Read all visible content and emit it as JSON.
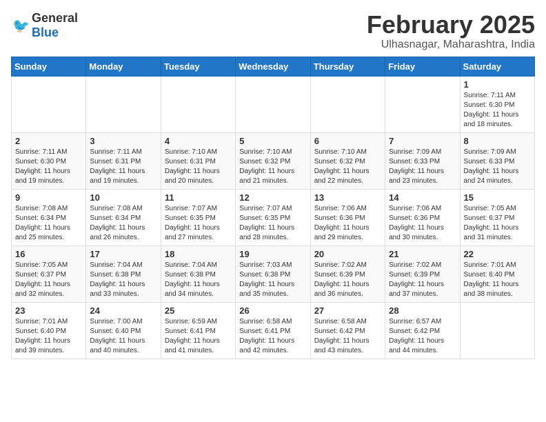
{
  "logo": {
    "general": "General",
    "blue": "Blue"
  },
  "title": "February 2025",
  "location": "Ulhasnagar, Maharashtra, India",
  "weekdays": [
    "Sunday",
    "Monday",
    "Tuesday",
    "Wednesday",
    "Thursday",
    "Friday",
    "Saturday"
  ],
  "weeks": [
    [
      {
        "day": "",
        "info": ""
      },
      {
        "day": "",
        "info": ""
      },
      {
        "day": "",
        "info": ""
      },
      {
        "day": "",
        "info": ""
      },
      {
        "day": "",
        "info": ""
      },
      {
        "day": "",
        "info": ""
      },
      {
        "day": "1",
        "info": "Sunrise: 7:11 AM\nSunset: 6:30 PM\nDaylight: 11 hours and 18 minutes."
      }
    ],
    [
      {
        "day": "2",
        "info": "Sunrise: 7:11 AM\nSunset: 6:30 PM\nDaylight: 11 hours and 19 minutes."
      },
      {
        "day": "3",
        "info": "Sunrise: 7:11 AM\nSunset: 6:31 PM\nDaylight: 11 hours and 19 minutes."
      },
      {
        "day": "4",
        "info": "Sunrise: 7:10 AM\nSunset: 6:31 PM\nDaylight: 11 hours and 20 minutes."
      },
      {
        "day": "5",
        "info": "Sunrise: 7:10 AM\nSunset: 6:32 PM\nDaylight: 11 hours and 21 minutes."
      },
      {
        "day": "6",
        "info": "Sunrise: 7:10 AM\nSunset: 6:32 PM\nDaylight: 11 hours and 22 minutes."
      },
      {
        "day": "7",
        "info": "Sunrise: 7:09 AM\nSunset: 6:33 PM\nDaylight: 11 hours and 23 minutes."
      },
      {
        "day": "8",
        "info": "Sunrise: 7:09 AM\nSunset: 6:33 PM\nDaylight: 11 hours and 24 minutes."
      }
    ],
    [
      {
        "day": "9",
        "info": "Sunrise: 7:08 AM\nSunset: 6:34 PM\nDaylight: 11 hours and 25 minutes."
      },
      {
        "day": "10",
        "info": "Sunrise: 7:08 AM\nSunset: 6:34 PM\nDaylight: 11 hours and 26 minutes."
      },
      {
        "day": "11",
        "info": "Sunrise: 7:07 AM\nSunset: 6:35 PM\nDaylight: 11 hours and 27 minutes."
      },
      {
        "day": "12",
        "info": "Sunrise: 7:07 AM\nSunset: 6:35 PM\nDaylight: 11 hours and 28 minutes."
      },
      {
        "day": "13",
        "info": "Sunrise: 7:06 AM\nSunset: 6:36 PM\nDaylight: 11 hours and 29 minutes."
      },
      {
        "day": "14",
        "info": "Sunrise: 7:06 AM\nSunset: 6:36 PM\nDaylight: 11 hours and 30 minutes."
      },
      {
        "day": "15",
        "info": "Sunrise: 7:05 AM\nSunset: 6:37 PM\nDaylight: 11 hours and 31 minutes."
      }
    ],
    [
      {
        "day": "16",
        "info": "Sunrise: 7:05 AM\nSunset: 6:37 PM\nDaylight: 11 hours and 32 minutes."
      },
      {
        "day": "17",
        "info": "Sunrise: 7:04 AM\nSunset: 6:38 PM\nDaylight: 11 hours and 33 minutes."
      },
      {
        "day": "18",
        "info": "Sunrise: 7:04 AM\nSunset: 6:38 PM\nDaylight: 11 hours and 34 minutes."
      },
      {
        "day": "19",
        "info": "Sunrise: 7:03 AM\nSunset: 6:38 PM\nDaylight: 11 hours and 35 minutes."
      },
      {
        "day": "20",
        "info": "Sunrise: 7:02 AM\nSunset: 6:39 PM\nDaylight: 11 hours and 36 minutes."
      },
      {
        "day": "21",
        "info": "Sunrise: 7:02 AM\nSunset: 6:39 PM\nDaylight: 11 hours and 37 minutes."
      },
      {
        "day": "22",
        "info": "Sunrise: 7:01 AM\nSunset: 6:40 PM\nDaylight: 11 hours and 38 minutes."
      }
    ],
    [
      {
        "day": "23",
        "info": "Sunrise: 7:01 AM\nSunset: 6:40 PM\nDaylight: 11 hours and 39 minutes."
      },
      {
        "day": "24",
        "info": "Sunrise: 7:00 AM\nSunset: 6:40 PM\nDaylight: 11 hours and 40 minutes."
      },
      {
        "day": "25",
        "info": "Sunrise: 6:59 AM\nSunset: 6:41 PM\nDaylight: 11 hours and 41 minutes."
      },
      {
        "day": "26",
        "info": "Sunrise: 6:58 AM\nSunset: 6:41 PM\nDaylight: 11 hours and 42 minutes."
      },
      {
        "day": "27",
        "info": "Sunrise: 6:58 AM\nSunset: 6:42 PM\nDaylight: 11 hours and 43 minutes."
      },
      {
        "day": "28",
        "info": "Sunrise: 6:57 AM\nSunset: 6:42 PM\nDaylight: 11 hours and 44 minutes."
      },
      {
        "day": "",
        "info": ""
      }
    ]
  ]
}
